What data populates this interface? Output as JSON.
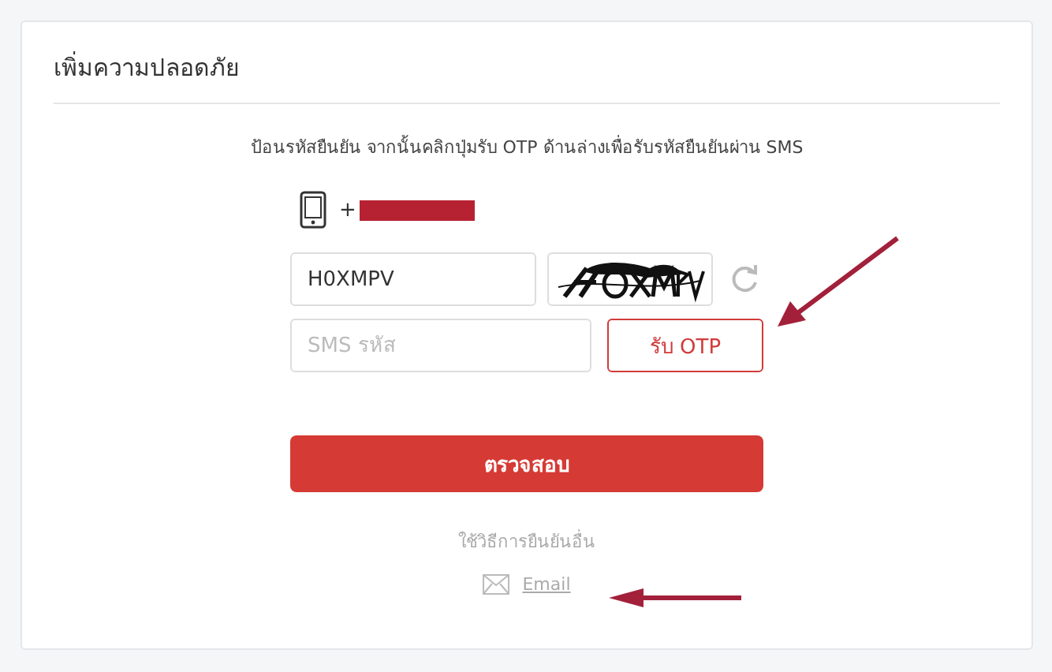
{
  "title": "เพิ่มความปลอดภัย",
  "instruction": "ป้อนรหัสยืนยัน จากนั้นคลิกปุ่มรับ OTP ด้านล่างเพื่อรับรหัสยืนยันผ่าน SMS",
  "phone": {
    "prefix": "+",
    "redacted": true
  },
  "captcha_field": {
    "value": "H0XMPV"
  },
  "sms_field": {
    "placeholder": "SMS รหัส"
  },
  "otp_button": "รับ OTP",
  "verify_button": "ตรวจสอบ",
  "other_methods_label": "ใช้วิธีการยืนยันอื่น",
  "other_methods": [
    {
      "kind": "email",
      "label": "Email"
    }
  ]
}
